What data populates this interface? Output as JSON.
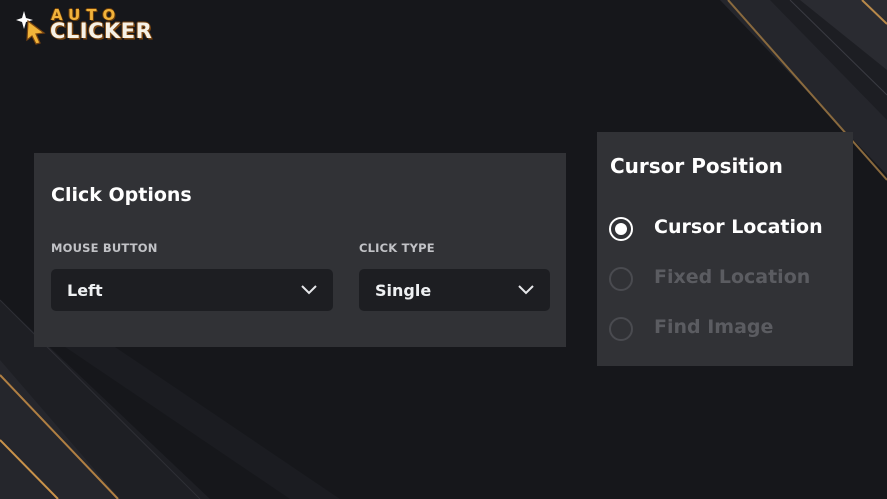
{
  "app": {
    "logo_top": "AUTO",
    "logo_bottom": "CLICKER"
  },
  "click_options": {
    "title": "Click Options",
    "mouse_button": {
      "label": "MOUSE BUTTON",
      "value": "Left"
    },
    "click_type": {
      "label": "CLICK TYPE",
      "value": "Single"
    }
  },
  "cursor_position": {
    "title": "Cursor Position",
    "options": [
      {
        "label": "Cursor Location",
        "checked": true
      },
      {
        "label": "Fixed Location",
        "checked": false
      },
      {
        "label": "Find Image",
        "checked": false
      }
    ]
  },
  "colors": {
    "background": "#17181c",
    "panel": "#313236",
    "select": "#1d1e22",
    "accent_gold": "#c9924a"
  }
}
